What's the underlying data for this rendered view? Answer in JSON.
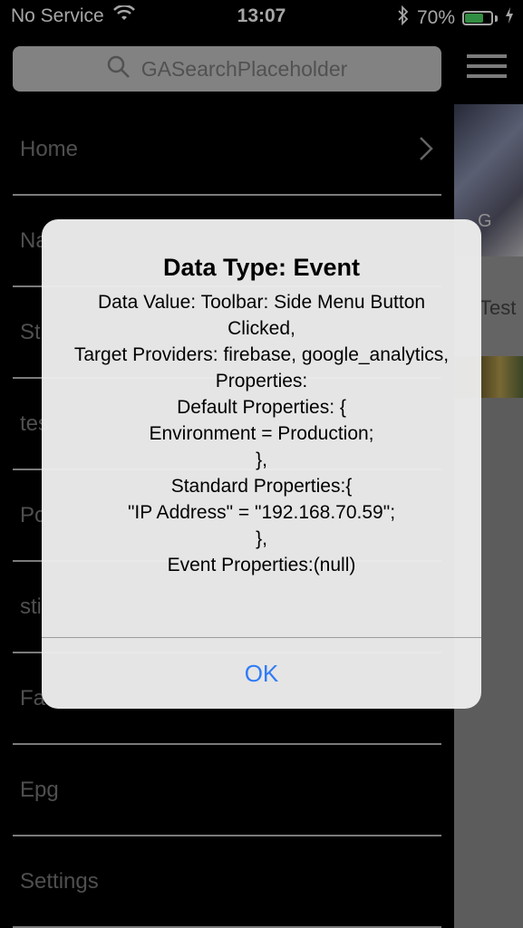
{
  "status_bar": {
    "carrier": "No Service",
    "time": "13:07",
    "battery_percent": "70%",
    "battery_level": 0.7
  },
  "search": {
    "placeholder": "GASearchPlaceholder"
  },
  "menu": {
    "items": [
      {
        "label": "Home"
      },
      {
        "label": "Na"
      },
      {
        "label": "St"
      },
      {
        "label": "tes"
      },
      {
        "label": "Po"
      },
      {
        "label": "sti"
      },
      {
        "label": "Fa"
      },
      {
        "label": "Epg"
      },
      {
        "label": "Settings"
      }
    ]
  },
  "right_panel": {
    "thumb1_label": "G",
    "thumb2_label": "Test"
  },
  "alert": {
    "title": "Data Type: Event",
    "message": "Data Value: Toolbar: Side Menu Button Clicked,\nTarget Providers: firebase, google_analytics,\nProperties:\nDefault Properties: {\nEnvironment = Production;\n},\nStandard Properties:{\n\"IP Address\" = \"192.168.70.59\";\n},\nEvent Properties:(null)",
    "ok_label": "OK"
  }
}
